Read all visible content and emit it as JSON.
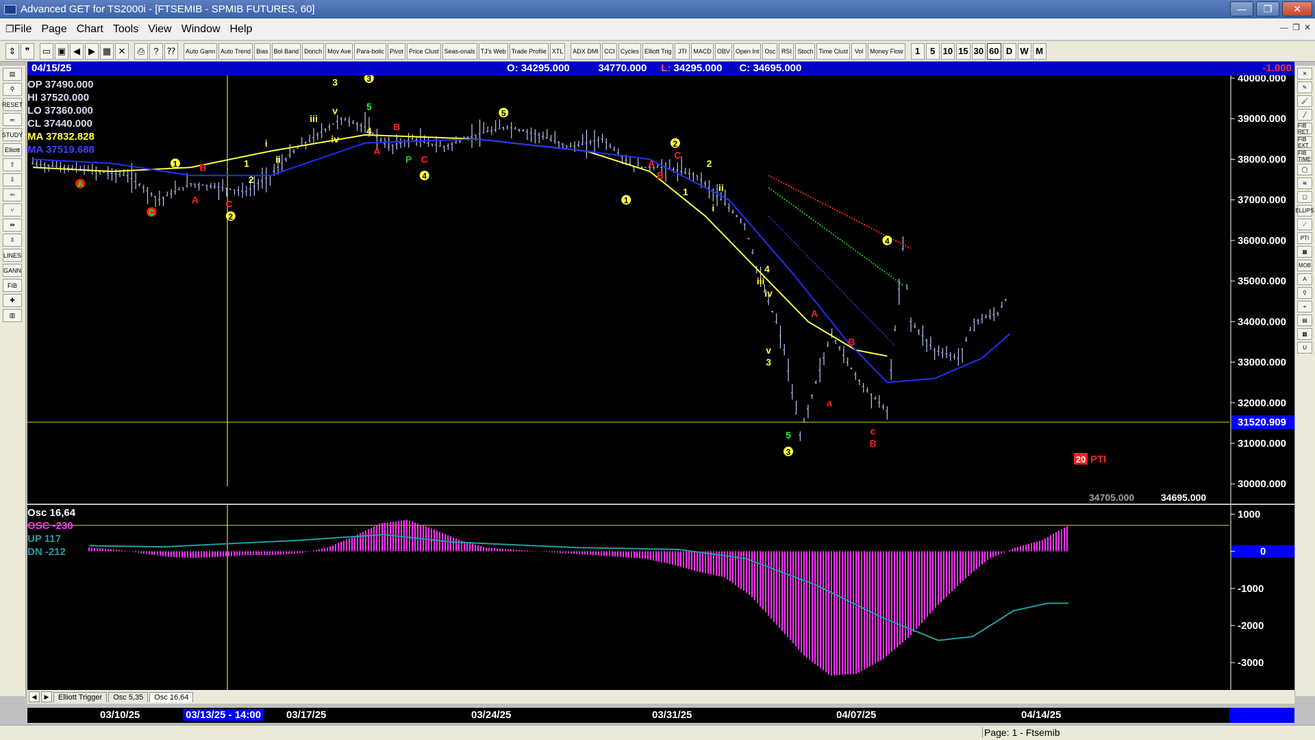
{
  "window": {
    "title": "Advanced GET for TS2000i - [FTSEMIB - SPMIB FUTURES, 60]"
  },
  "menu": [
    "File",
    "Page",
    "Chart",
    "Tools",
    "View",
    "Window",
    "Help"
  ],
  "toolbar": {
    "studies": [
      "Auto Gann",
      "Auto Trend",
      "Bias",
      "Bol Band",
      "Donch",
      "Mov Ave",
      "Para-bolic",
      "Pivot",
      "Price Clust",
      "Seas-onals",
      "TJ's Web",
      "Trade Profile",
      "XTL",
      "ADX DMI",
      "CCI",
      "Cycles",
      "Elliott Trig",
      "JTI",
      "MACD",
      "OBV",
      "Open Int",
      "Osc",
      "RSI",
      "Stoch",
      "Time Clust",
      "Vol",
      "Money Flow"
    ],
    "timeframes": [
      "1",
      "5",
      "10",
      "15",
      "30",
      "60",
      "D",
      "W",
      "M"
    ],
    "active_timeframe": "60"
  },
  "left_tools": [
    "RESET",
    "STUDY",
    "Elliott",
    "LINES",
    "GANN",
    "FIB"
  ],
  "right_tools": [
    "FIB RET",
    "FIB EXT",
    "FIB TIME",
    "ELLIPS",
    "PTI",
    "MOB",
    "U"
  ],
  "header": {
    "date": "04/15/25",
    "open_label": "O:",
    "open": "34295.000",
    "high": "34770.000",
    "low_label": "L:",
    "low": "34295.000",
    "close_label": "C:",
    "close": "34695.000",
    "change": "-1.000"
  },
  "info": [
    "OP 37490.000",
    "HI  37520.000",
    "LO  37360.000",
    "CL  37440.000",
    "MA  37832.828",
    "MA  37519.688"
  ],
  "osc_info": {
    "title": "Osc 16,64",
    "osc": "OSC -230",
    "up": "UP   117",
    "dn": "DN   -212"
  },
  "price_axis": [
    "40000.000",
    "39000.000",
    "38000.000",
    "37000.000",
    "36000.000",
    "35000.000",
    "34000.000",
    "33000.000",
    "32000.000",
    "31000.000",
    "30000.000"
  ],
  "price_marker": "31520.909",
  "bottom_values": [
    "34705.000",
    "34695.000"
  ],
  "pti": {
    "value": "20",
    "label": "PTI"
  },
  "osc_axis": [
    "1000",
    "0",
    "-1000",
    "-2000",
    "-3000"
  ],
  "tabs": [
    "Elliott Trigger",
    "Osc 5,35",
    "Osc 16,64"
  ],
  "active_tab": "Osc 16,64",
  "dates": [
    "03/10/25",
    "03/13/25 - 14:00",
    "03/17/25",
    "03/24/25",
    "03/31/25",
    "04/07/25",
    "04/14/25"
  ],
  "status": "Page: 1 - Ftsemib",
  "colors": {
    "ma_fast": "#ffff40",
    "ma_slow": "#2030ff",
    "osc_bar": "#ff30ff",
    "osc_line": "#20a0a0",
    "header_bg": "#0000c8"
  },
  "chart_data": {
    "type": "line",
    "title": "",
    "ylim": [
      29700,
      40000
    ],
    "price_path": [
      [
        0,
        37900
      ],
      [
        40,
        37800
      ],
      [
        80,
        37700
      ],
      [
        120,
        37600
      ],
      [
        160,
        37000
      ],
      [
        200,
        37400
      ],
      [
        240,
        37300
      ],
      [
        270,
        37200
      ],
      [
        300,
        37600
      ],
      [
        330,
        38200
      ],
      [
        360,
        38600
      ],
      [
        390,
        39000
      ],
      [
        420,
        38800
      ],
      [
        450,
        38300
      ],
      [
        480,
        38500
      ],
      [
        520,
        38300
      ],
      [
        560,
        38600
      ],
      [
        600,
        38800
      ],
      [
        640,
        38600
      ],
      [
        680,
        38300
      ],
      [
        720,
        38500
      ],
      [
        760,
        37800
      ],
      [
        800,
        37800
      ],
      [
        840,
        37600
      ],
      [
        870,
        37000
      ],
      [
        900,
        36400
      ],
      [
        920,
        35000
      ],
      [
        940,
        34000
      ],
      [
        950,
        33300
      ],
      [
        970,
        31200
      ],
      [
        990,
        32500
      ],
      [
        1010,
        33700
      ],
      [
        1030,
        33000
      ],
      [
        1050,
        32400
      ],
      [
        1080,
        31800
      ],
      [
        1100,
        35800
      ],
      [
        1110,
        34000
      ],
      [
        1140,
        33300
      ],
      [
        1170,
        33100
      ],
      [
        1190,
        34000
      ],
      [
        1220,
        34200
      ],
      [
        1235,
        34700
      ]
    ],
    "ma_fast_path": [
      [
        0,
        37800
      ],
      [
        100,
        37700
      ],
      [
        200,
        37800
      ],
      [
        300,
        38200
      ],
      [
        420,
        38600
      ],
      [
        560,
        38500
      ],
      [
        700,
        38200
      ],
      [
        780,
        37700
      ],
      [
        850,
        36600
      ],
      [
        920,
        35200
      ],
      [
        980,
        34000
      ],
      [
        1040,
        33300
      ],
      [
        1080,
        33150
      ]
    ],
    "ma_slow_path": [
      [
        0,
        38000
      ],
      [
        100,
        37900
      ],
      [
        200,
        37600
      ],
      [
        300,
        37600
      ],
      [
        420,
        38400
      ],
      [
        560,
        38500
      ],
      [
        700,
        38200
      ],
      [
        780,
        38000
      ],
      [
        880,
        37000
      ],
      [
        960,
        35200
      ],
      [
        1030,
        33500
      ],
      [
        1080,
        32500
      ],
      [
        1140,
        32600
      ],
      [
        1200,
        33100
      ],
      [
        1235,
        33700
      ]
    ],
    "osc_values": [
      0.1,
      0.05,
      -0.05,
      -0.15,
      -0.18,
      -0.15,
      -0.1,
      -0.1,
      -0.05,
      0.1,
      0.4,
      0.75,
      0.85,
      0.6,
      0.3,
      0.1,
      0.05,
      0.0,
      -0.05,
      -0.1,
      -0.15,
      -0.2,
      -0.35,
      -0.55,
      -0.7,
      -1.2,
      -2.0,
      -2.8,
      -3.35,
      -3.3,
      -2.9,
      -2.3,
      -1.5,
      -0.8,
      -0.2,
      0.1,
      0.3,
      0.7
    ]
  }
}
